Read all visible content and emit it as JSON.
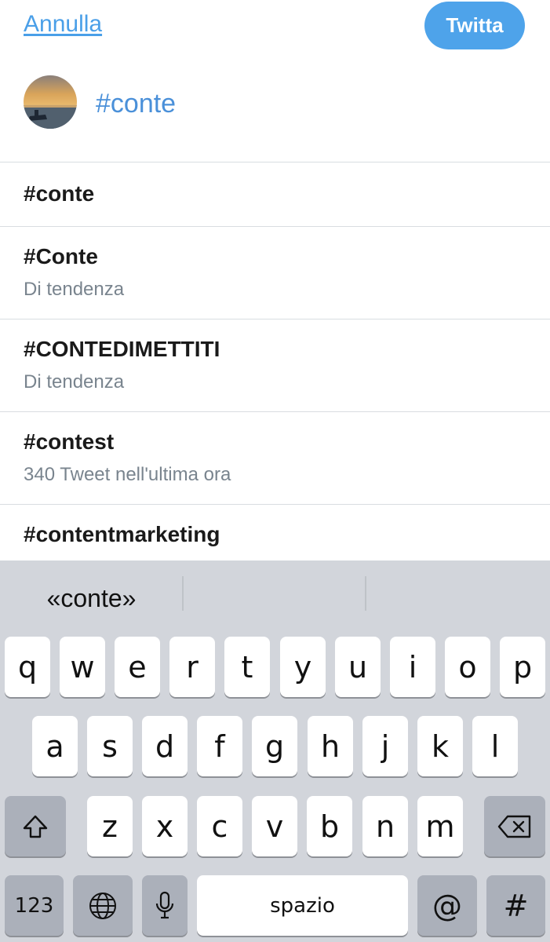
{
  "header": {
    "cancel_label": "Annulla",
    "tweet_label": "Twitta",
    "composer_text": "#conte"
  },
  "suggestions": [
    {
      "tag": "#conte",
      "subtitle": ""
    },
    {
      "tag": "#Conte",
      "subtitle": "Di tendenza"
    },
    {
      "tag": "#CONTEDIMETTITI",
      "subtitle": "Di tendenza"
    },
    {
      "tag": "#contest",
      "subtitle": "340 Tweet nell'ultima ora"
    },
    {
      "tag": "#contentmarketing",
      "subtitle": ""
    }
  ],
  "keyboard": {
    "prediction": "«conte»",
    "row1": [
      "q",
      "w",
      "e",
      "r",
      "t",
      "y",
      "u",
      "i",
      "o",
      "p"
    ],
    "row2": [
      "a",
      "s",
      "d",
      "f",
      "g",
      "h",
      "j",
      "k",
      "l"
    ],
    "row3": [
      "z",
      "x",
      "c",
      "v",
      "b",
      "n",
      "m"
    ],
    "numbers_label": "123",
    "space_label": "spazio",
    "at_label": "@",
    "hash_label": "#"
  },
  "colors": {
    "accent": "#4ea3ea",
    "link": "#4a9fe8",
    "keyboard_bg": "#d2d5db",
    "key_dark": "#abb0ba"
  },
  "icons": [
    "globe-icon",
    "microphone-icon",
    "shift-icon",
    "backspace-icon"
  ]
}
